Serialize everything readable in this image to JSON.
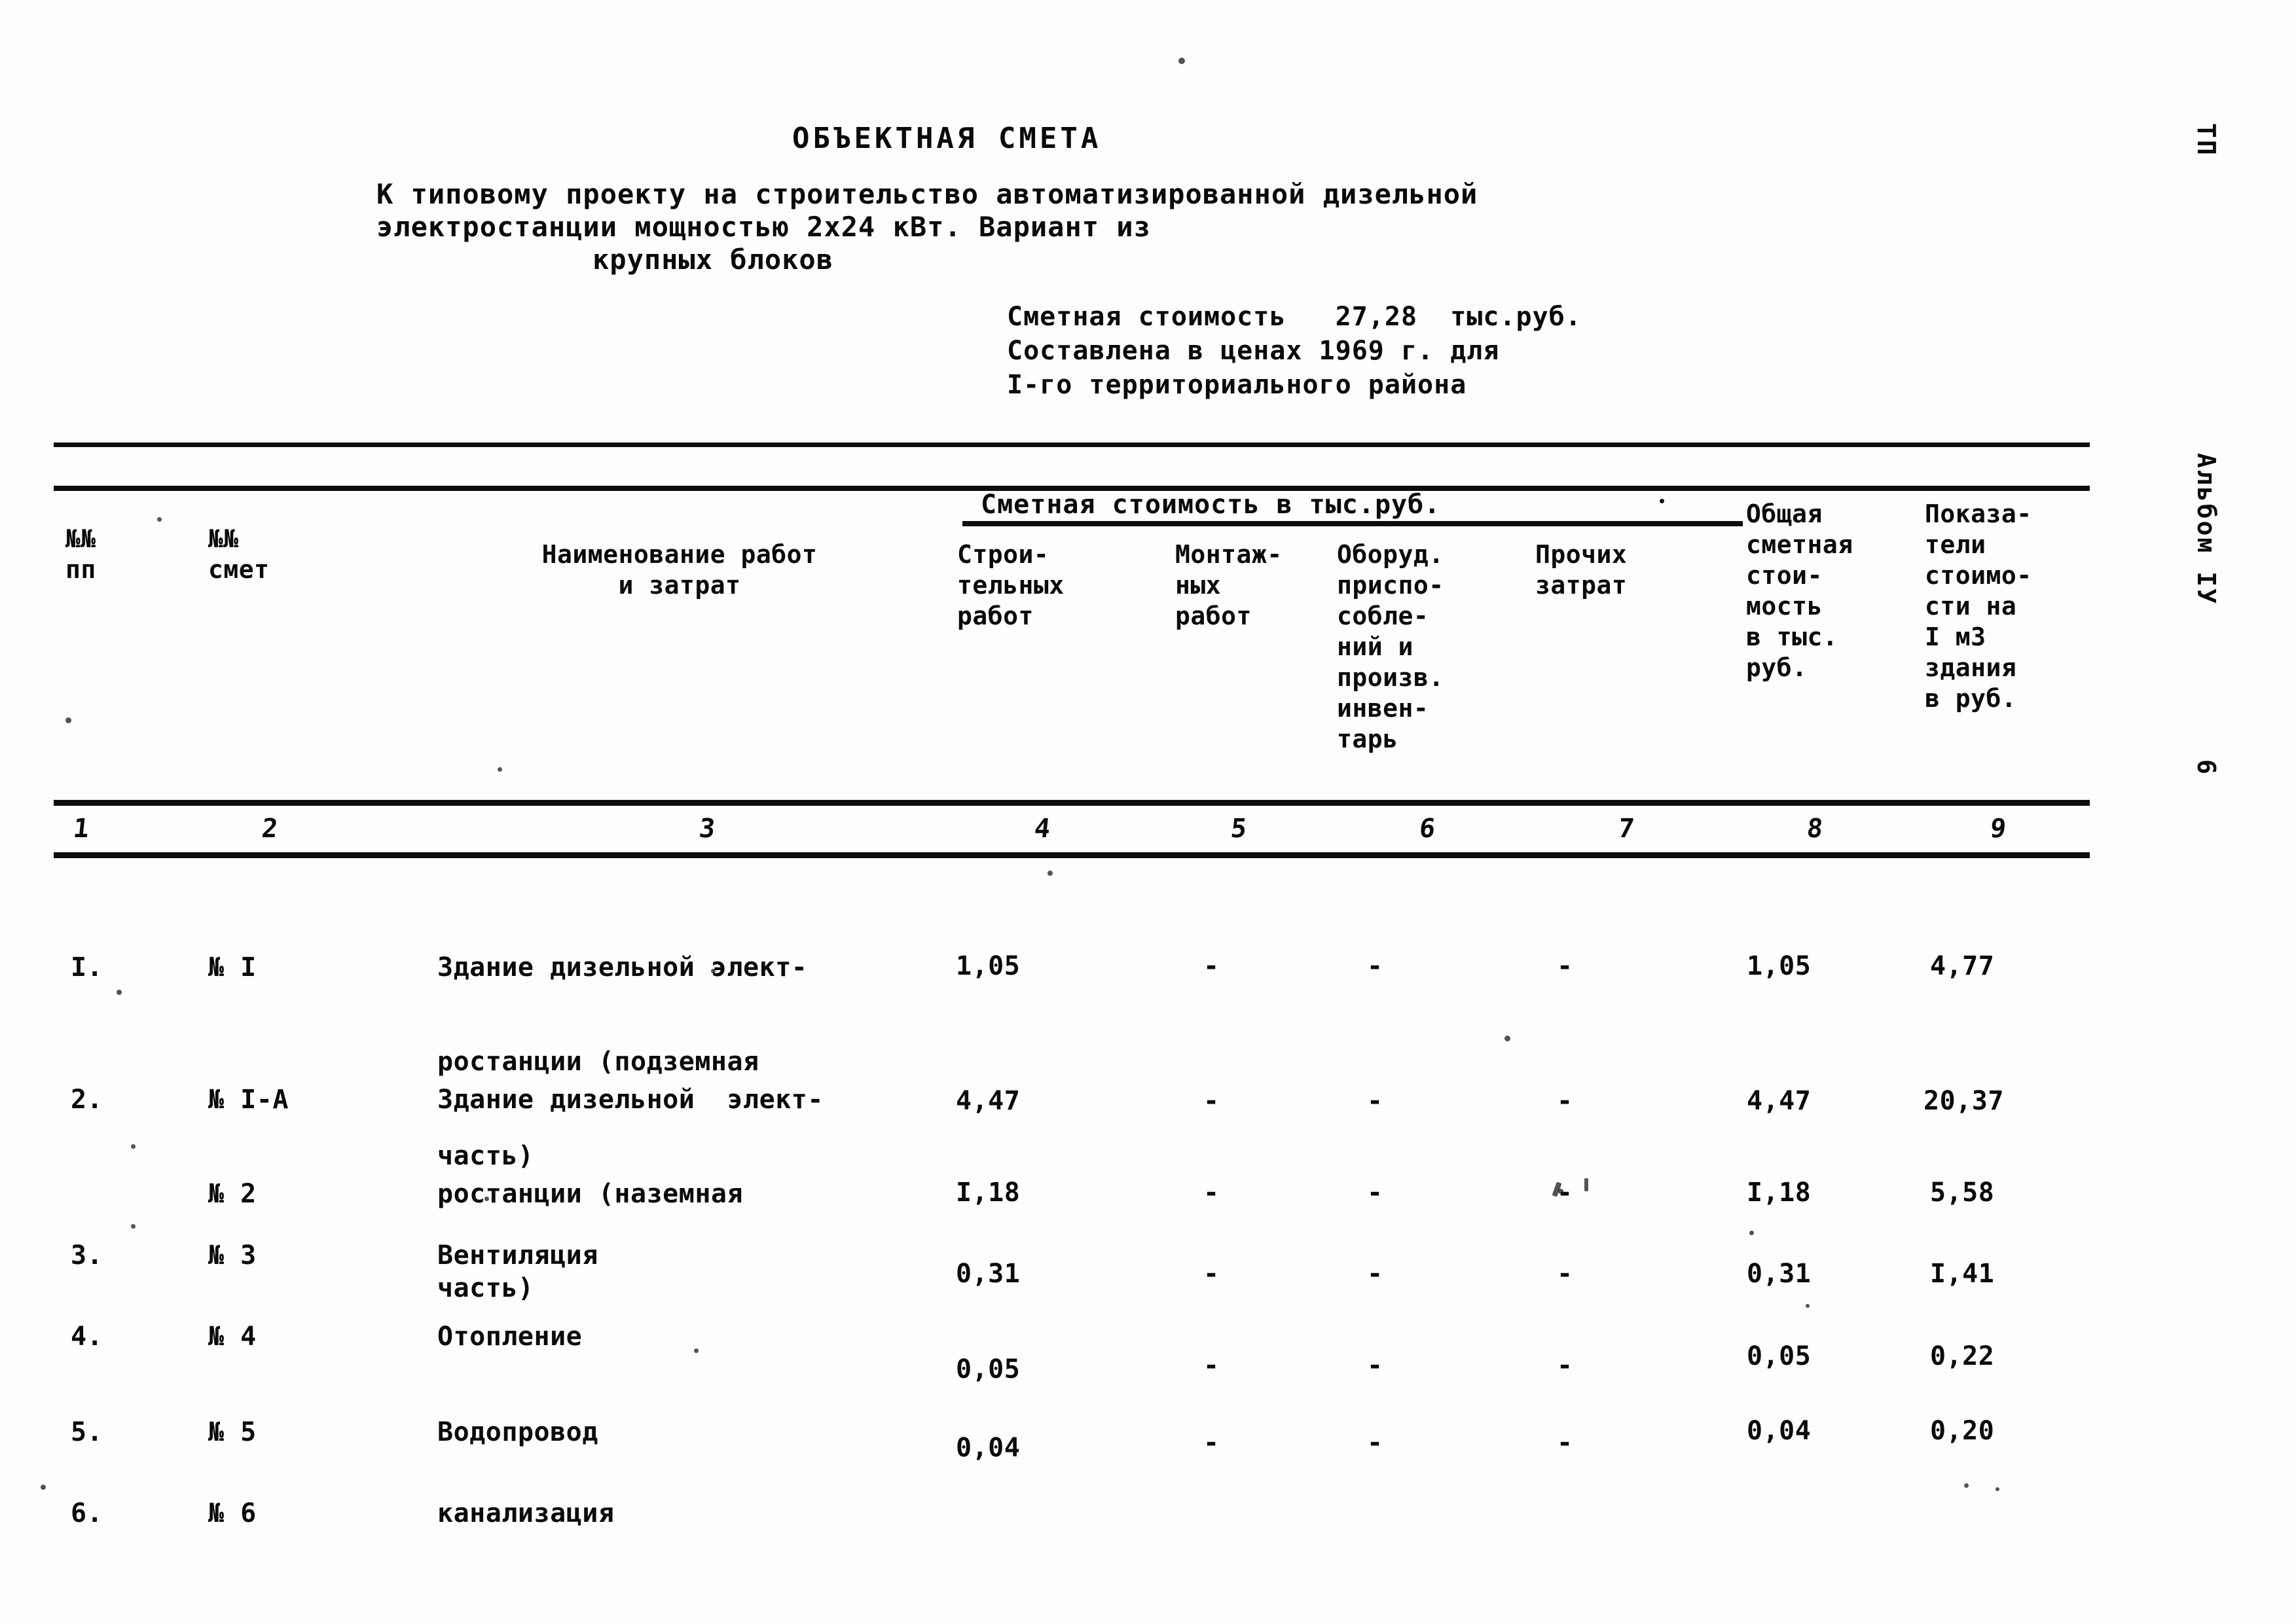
{
  "document": {
    "title": "ОБЪЕКТНАЯ СМЕТА",
    "subtitle_line1": "К типовому проекту на строительство автоматизированной",
    "subtitle_line2": "дизельной электростанции мощностью 2х24 кВт. Вариант из",
    "subtitle_line3": "крупных блоков",
    "cost_line1": "Сметная стоимость   27,28  тыс.руб.",
    "cost_line2": "Составлена в ценах 1969 г. для",
    "cost_line3": "I-го территориального района"
  },
  "margin": {
    "sheet_code": "ТП",
    "album": "Альбом IУ",
    "page_number": "6"
  },
  "table": {
    "span_header": "Сметная стоимость в тыс.руб.",
    "headers": {
      "c1_line1": "№№",
      "c1_line2": "пп",
      "c2_line1": "№№",
      "c2_line2": "смет",
      "c3_line1": "Наименование работ",
      "c3_line2": "и затрат",
      "c4": [
        "Строи-",
        "тельных",
        "работ"
      ],
      "c5": [
        "Монтаж-",
        "ных",
        "работ"
      ],
      "c6": [
        "Оборуд.",
        "приспо-",
        "соблe-",
        "ний и",
        "произв.",
        "инвен-",
        "тарь"
      ],
      "c7": [
        "Прочих",
        "затрат"
      ],
      "c8": [
        "Общая",
        "сметная",
        "стои-",
        "мость",
        "в тыс.",
        "руб."
      ],
      "c9": [
        "Показа-",
        "тели",
        "стоимо-",
        "сти на",
        "I м3",
        "здания",
        "в руб."
      ]
    },
    "column_numbers": [
      "1",
      "2",
      "3",
      "4",
      "5",
      "6",
      "7",
      "8",
      "9"
    ],
    "rows": [
      {
        "pp": "I.",
        "smeta": [
          "№ I"
        ],
        "name": [
          "Здание дизельной элект-",
          "ростанции (подземная",
          "часть)"
        ],
        "stroit": "1,05",
        "montazh": "-",
        "oborud": "-",
        "prochie": "-",
        "obshchaya": "1,05",
        "pokazatel": "4,77"
      },
      {
        "pp": "2.",
        "smeta": [
          "№ I-A",
          "№ 2"
        ],
        "name": [
          "Здание дизельной  элект-",
          "ростанции (наземная",
          "часть)"
        ],
        "stroit": "4,47",
        "montazh": "-",
        "oborud": "-",
        "prochie": "-",
        "obshchaya": "4,47",
        "pokazatel": "20,37"
      },
      {
        "pp": "3.",
        "smeta": [
          "№ 3"
        ],
        "name": [
          "Вентиляция"
        ],
        "stroit": "I,18",
        "montazh": "-",
        "oborud": "-",
        "prochie": "-",
        "obshchaya": "I,18",
        "pokazatel": "5,58"
      },
      {
        "pp": "4.",
        "smeta": [
          "№ 4"
        ],
        "name": [
          "Отопление"
        ],
        "stroit": "0,31",
        "montazh": "-",
        "oborud": "-",
        "prochie": "-",
        "obshchaya": "0,31",
        "pokazatel": "I,41"
      },
      {
        "pp": "5.",
        "smeta": [
          "№ 5"
        ],
        "name": [
          "Водопровод"
        ],
        "stroit": "0,05",
        "montazh": "-",
        "oborud": "-",
        "prochie": "-",
        "obshchaya": "0,05",
        "pokazatel": "0,22"
      },
      {
        "pp": "6.",
        "smeta": [
          "№ 6"
        ],
        "name": [
          "канализация"
        ],
        "stroit": "0,04",
        "montazh": "-",
        "oborud": "-",
        "prochie": "-",
        "obshchaya": "0,04",
        "pokazatel": "0,20"
      }
    ]
  }
}
